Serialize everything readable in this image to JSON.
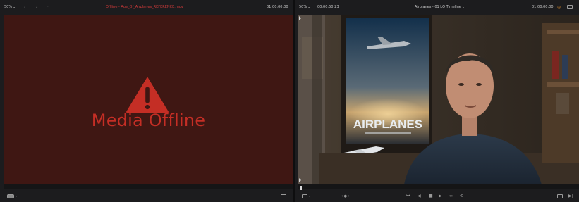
{
  "source_viewer": {
    "zoom": "50%",
    "clip_name": "Offline - Age_Of_Airplanes_REFERENCE.mov",
    "timecode": "01:00:00:00",
    "offline_message": "Media Offline",
    "colors": {
      "offline_bg": "#3f1713",
      "alert": "#c42e25",
      "clip_name": "#d23a3a"
    }
  },
  "timeline_viewer": {
    "zoom": "50%",
    "duration": "00:00:50:23",
    "title": "Airplanes - 01 LQ Timeline",
    "timecode": "01:00:00:00"
  },
  "icons": {
    "warning": "warning-triangle-icon",
    "loop": "loop-icon",
    "go_to_start": "go-to-start-icon",
    "play_reverse": "play-reverse-icon",
    "stop": "stop-icon",
    "play": "play-icon",
    "go_to_end": "go-to-end-icon"
  }
}
